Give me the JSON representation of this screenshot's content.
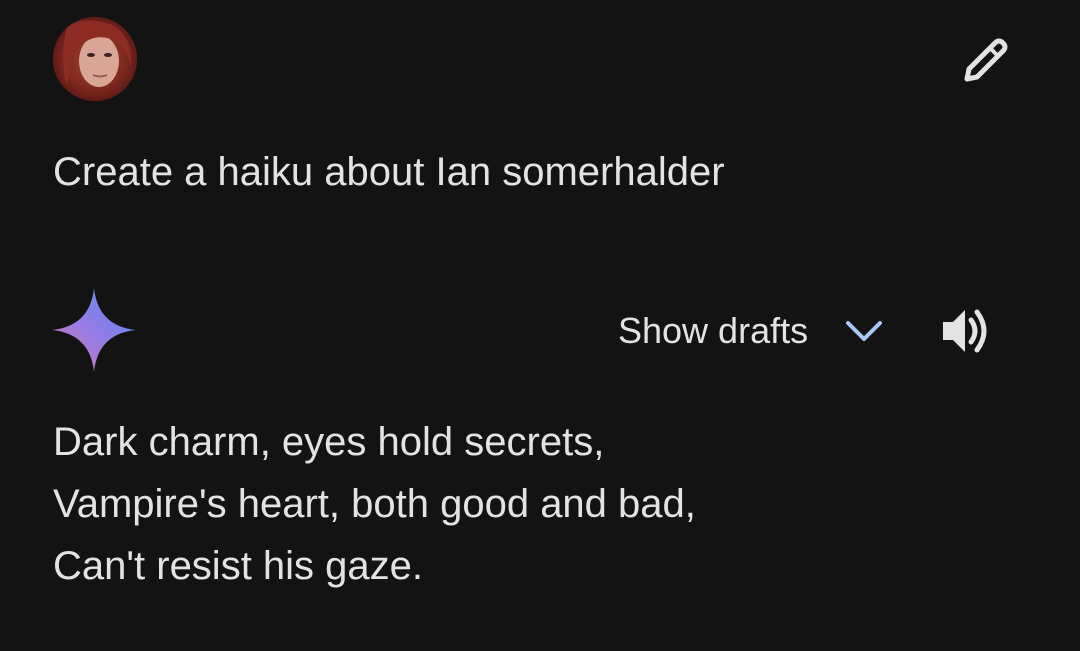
{
  "user_turn": {
    "avatar_icon": "user-avatar-photo",
    "edit_icon": "pencil-icon",
    "prompt": "Create a haiku about Ian somerhalder"
  },
  "model_turn": {
    "logo_icon": "gemini-sparkle-icon",
    "show_drafts_label": "Show drafts",
    "chevron_icon": "chevron-down-icon",
    "speaker_icon": "speaker-icon",
    "response_lines": [
      "Dark charm, eyes hold secrets,",
      "Vampire's heart, both good and bad,",
      "Can't resist his gaze."
    ]
  },
  "colors": {
    "background": "#131314",
    "text": "#e3e3e3",
    "chevron": "#a8c7fa",
    "sparkle_gradient": [
      "#4f8df5",
      "#9a7be3",
      "#d97ba3"
    ]
  }
}
